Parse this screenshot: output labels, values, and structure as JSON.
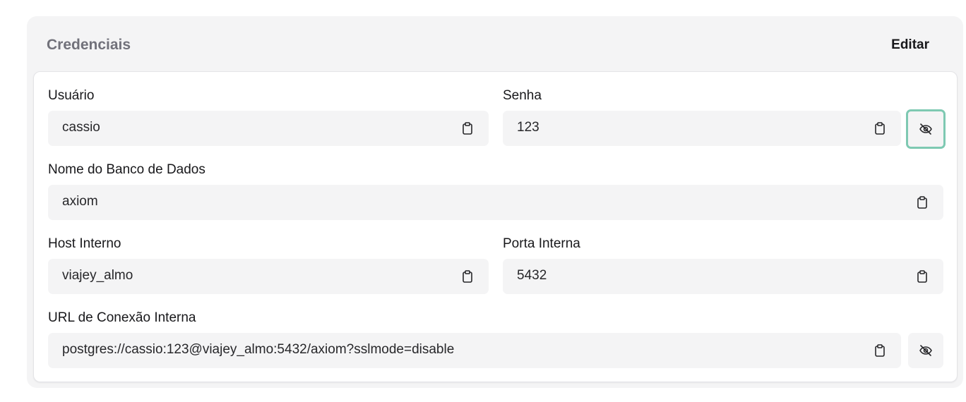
{
  "card": {
    "title": "Credenciais",
    "edit_label": "Editar"
  },
  "fields": {
    "user": {
      "label": "Usuário",
      "value": "cassio"
    },
    "password": {
      "label": "Senha",
      "value": "123"
    },
    "database": {
      "label": "Nome do Banco de Dados",
      "value": "axiom"
    },
    "host": {
      "label": "Host Interno",
      "value": "viajey_almo"
    },
    "port": {
      "label": "Porta Interna",
      "value": "5432"
    },
    "url": {
      "label": "URL de Conexão Interna",
      "value": "postgres://cassio:123@viajey_almo:5432/axiom?sslmode=disable"
    }
  },
  "icons": {
    "copy": "clipboard-icon",
    "toggle_visibility": "eye-off-icon"
  },
  "colors": {
    "focus_ring": "#7ec9b2",
    "field_bg": "#f4f4f5"
  }
}
